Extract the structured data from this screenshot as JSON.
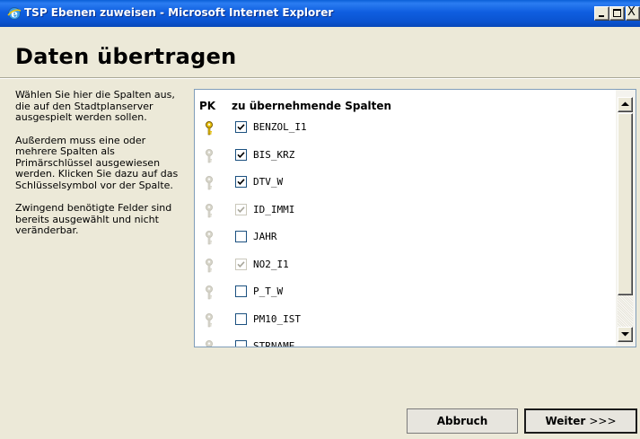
{
  "window": {
    "title": "TSP Ebenen zuweisen - Microsoft Internet Explorer",
    "controls": {
      "minimize": "minimize",
      "maximize": "maximize",
      "close": "X"
    }
  },
  "page": {
    "title": "Daten übertragen"
  },
  "help": {
    "paragraphs": [
      "Wählen Sie hier die Spalten aus, die auf den Stadtplanserver ausgespielt werden sollen.",
      "Außerdem muss eine oder mehrere Spalten als Primärschlüssel ausgewiesen werden. Klicken Sie dazu auf das Schlüsselsymbol vor der Spalte.",
      "Zwingend benötigte Felder sind bereits ausgewählt und nicht veränderbar."
    ]
  },
  "table": {
    "header_pk": "PK",
    "header_columns": "zu übernehmende Spalten",
    "rows": [
      {
        "name": "BENZOL_I1",
        "pk": true,
        "checked": true,
        "disabled": false
      },
      {
        "name": "BIS_KRZ",
        "pk": false,
        "checked": true,
        "disabled": false
      },
      {
        "name": "DTV_W",
        "pk": false,
        "checked": true,
        "disabled": false
      },
      {
        "name": "ID_IMMI",
        "pk": false,
        "checked": true,
        "disabled": true
      },
      {
        "name": "JAHR",
        "pk": false,
        "checked": false,
        "disabled": false
      },
      {
        "name": "NO2_I1",
        "pk": false,
        "checked": true,
        "disabled": true
      },
      {
        "name": "P_T_W",
        "pk": false,
        "checked": false,
        "disabled": false
      },
      {
        "name": "PM10_IST",
        "pk": false,
        "checked": false,
        "disabled": false
      },
      {
        "name": "STRNAME",
        "pk": false,
        "checked": false,
        "disabled": false
      }
    ]
  },
  "buttons": {
    "cancel": "Abbruch",
    "next_label": "Weiter",
    "next_arrows": ">>>"
  },
  "colors": {
    "titlebar": "#0a53d0",
    "key_active": "#e8c20e",
    "key_inactive": "#d9d7cc",
    "checkbox_border": "#1c5180"
  },
  "icons": {
    "window": "ie-icon",
    "primary_key": "key-icon",
    "scroll_up": "arrow-up-icon",
    "scroll_down": "arrow-down-icon"
  }
}
